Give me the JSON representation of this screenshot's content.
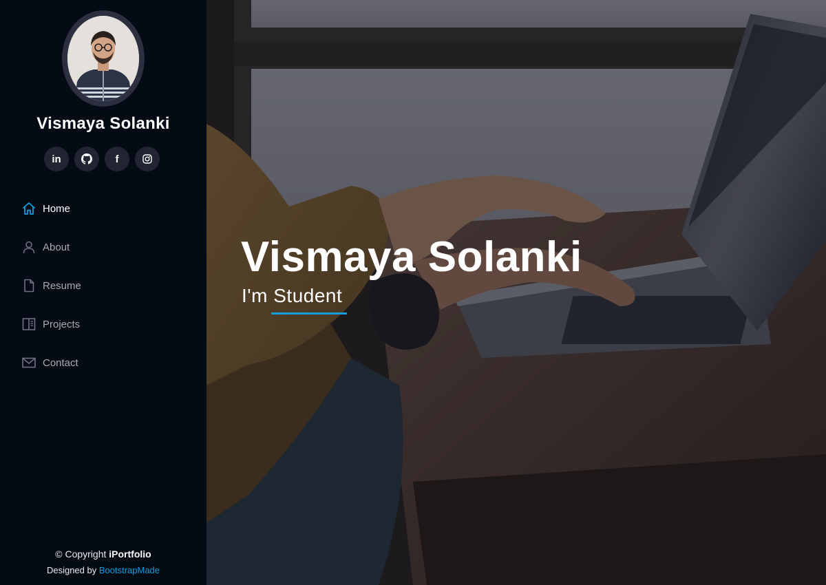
{
  "profile": {
    "name": "Vismaya Solanki",
    "avatar_icon": "profile-photo"
  },
  "social": [
    {
      "name": "linkedin",
      "icon": "linkedin-icon",
      "label": "in"
    },
    {
      "name": "github",
      "icon": "github-icon"
    },
    {
      "name": "facebook",
      "icon": "facebook-icon",
      "label": "f"
    },
    {
      "name": "instagram",
      "icon": "instagram-icon"
    }
  ],
  "nav": {
    "items": [
      {
        "label": "Home",
        "icon": "home-icon",
        "active": true
      },
      {
        "label": "About",
        "icon": "user-icon",
        "active": false
      },
      {
        "label": "Resume",
        "icon": "file-icon",
        "active": false
      },
      {
        "label": "Projects",
        "icon": "book-icon",
        "active": false
      },
      {
        "label": "Contact",
        "icon": "envelope-icon",
        "active": false
      }
    ]
  },
  "hero": {
    "title": "Vismaya Solanki",
    "prefix": "I'm ",
    "typed": "Student"
  },
  "footer": {
    "copyright_prefix": "© Copyright ",
    "brand": "iPortfolio",
    "credits_prefix": "Designed by ",
    "credits_link": "BootstrapMade"
  },
  "colors": {
    "accent": "#149ddd",
    "sidebar_bg": "#040b14",
    "social_bg": "#212431",
    "nav_text": "#a8a9b4"
  }
}
